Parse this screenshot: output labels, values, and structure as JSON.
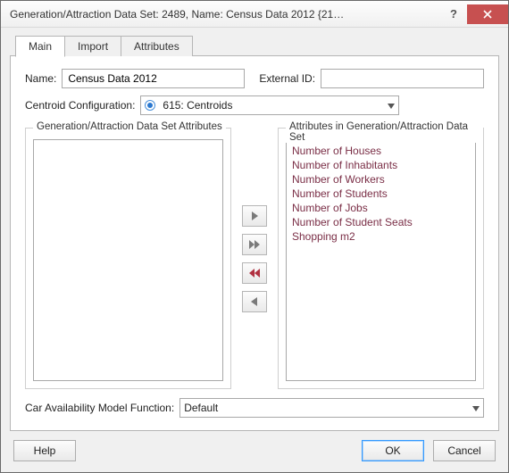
{
  "window": {
    "title": "Generation/Attraction Data Set: 2489, Name: Census Data 2012  {21…"
  },
  "tabs": {
    "main": "Main",
    "import": "Import",
    "attributes": "Attributes"
  },
  "fields": {
    "name_label": "Name:",
    "name_value": "Census Data 2012",
    "external_id_label": "External ID:",
    "external_id_value": "",
    "centroid_label": "Centroid Configuration:",
    "centroid_value": "615: Centroids",
    "car_label": "Car Availability Model Function:",
    "car_value": "Default"
  },
  "groupboxes": {
    "left_title": "Generation/Attraction Data Set Attributes",
    "right_title": "Attributes in Generation/Attraction Data Set"
  },
  "right_list": [
    "Number of Houses",
    "Number of Inhabitants",
    "Number of Workers",
    "Number of Students",
    "Number of Jobs",
    "Number of Student Seats",
    "Shopping m2"
  ],
  "buttons": {
    "help": "Help",
    "ok": "OK",
    "cancel": "Cancel"
  }
}
